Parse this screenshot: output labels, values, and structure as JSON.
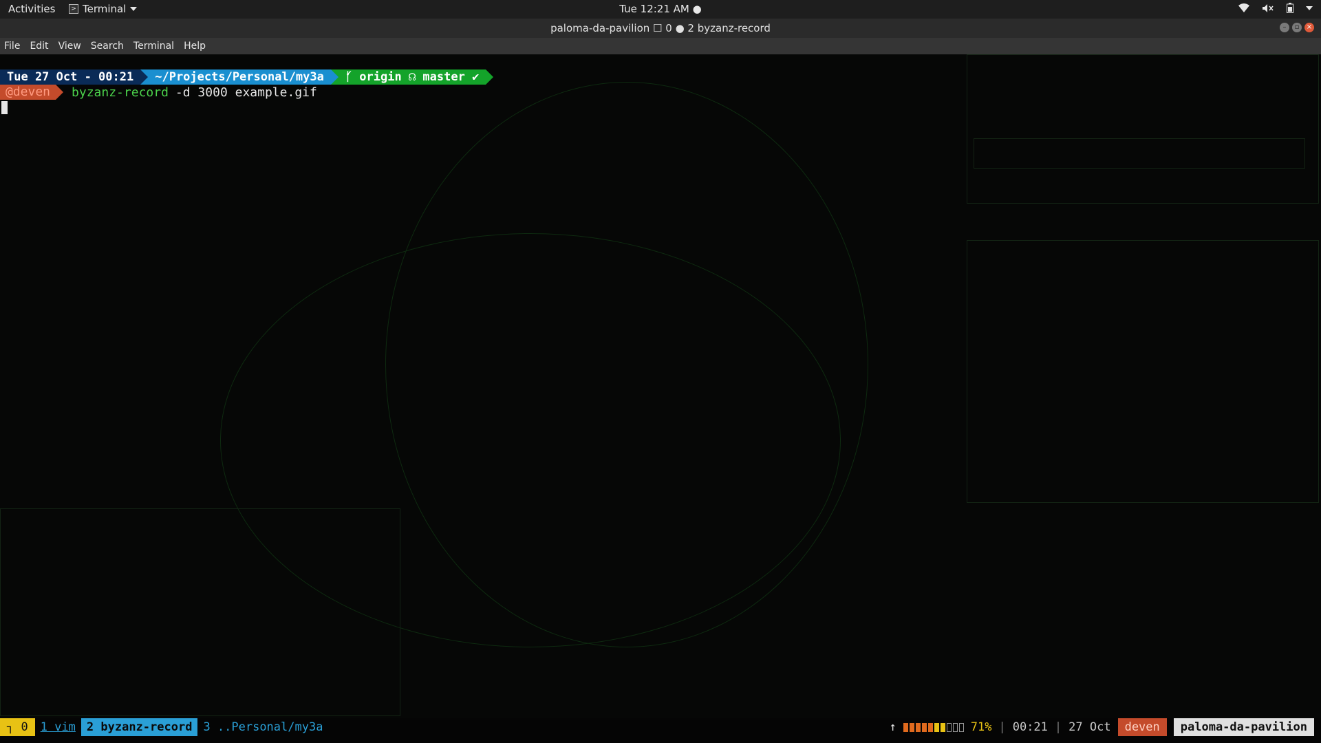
{
  "topbar": {
    "activities": "Activities",
    "app_menu": "Terminal",
    "clock": "Tue 12:21 AM ●"
  },
  "window": {
    "title": "paloma-da-pavilion ☐ 0 ● 2 byzanz-record"
  },
  "menubar": [
    "File",
    "Edit",
    "View",
    "Search",
    "Terminal",
    "Help"
  ],
  "prompt": {
    "date": "Tue 27 Oct - 00:21",
    "path": "~/Projects/Personal/my3a",
    "git": "ᚶ origin ☊ master ✔",
    "user": "@deven",
    "command": "byzanz-record",
    "args": "-d 3000 example.gif"
  },
  "status": {
    "session": "┐ 0",
    "windows": [
      {
        "label": "1 vim",
        "state": "inactive-1"
      },
      {
        "label": "2 byzanz-record",
        "state": "active"
      },
      {
        "label": "3 ..Personal/my3a",
        "state": "inactive"
      }
    ],
    "up_arrow": "↑",
    "battery_percent": "71%",
    "battery_level": 0.71,
    "time": "00:21",
    "date": "27 Oct",
    "user": "deven",
    "host": "paloma-da-pavilion",
    "separator": "|"
  },
  "colors": {
    "date_bg": "#0a2b57",
    "path_bg": "#1a8fd0",
    "git_bg": "#14a32a",
    "user_bg": "#c44b2b",
    "session_bg": "#e8c214",
    "active_window_bg": "#2a9fd6"
  }
}
